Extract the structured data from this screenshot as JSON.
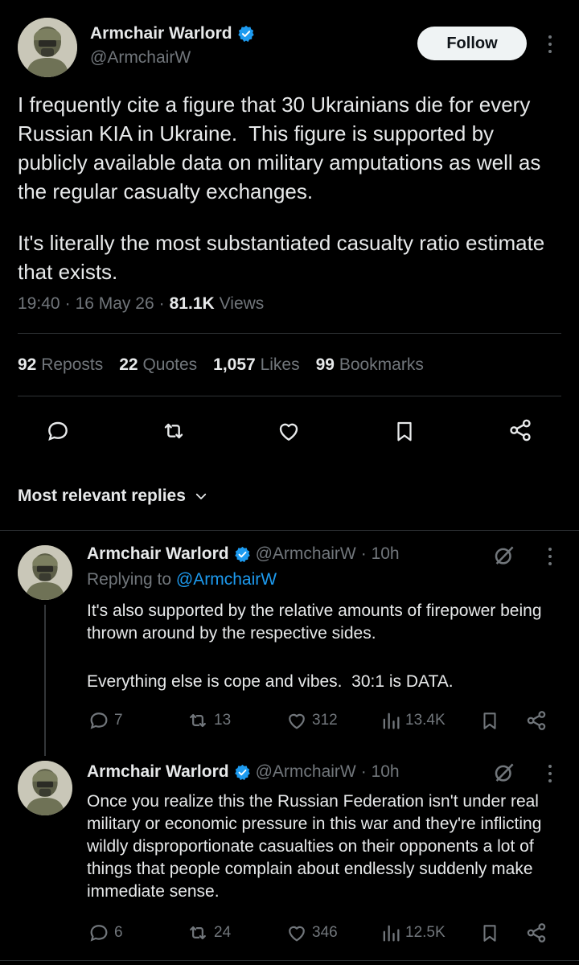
{
  "main_tweet": {
    "author_name": "Armchair Warlord",
    "handle": "@ArmchairW",
    "follow_label": "Follow",
    "text_p1": "I frequently cite a figure that 30 Ukrainians die for every Russian KIA in Ukraine.  This figure is supported by publicly available data on military amputations as well as the regular casualty exchanges.",
    "text_p2": "It's literally the most substantiated casualty ratio estimate that exists.",
    "time": "19:40",
    "date": "16 May 26",
    "views_count": "81.1K",
    "views_label": "Views",
    "sep": "·",
    "stats": {
      "reposts_count": "92",
      "reposts_label": "Reposts",
      "quotes_count": "22",
      "quotes_label": "Quotes",
      "likes_count": "1,057",
      "likes_label": "Likes",
      "bookmarks_count": "99",
      "bookmarks_label": "Bookmarks"
    }
  },
  "replies_header": {
    "label": "Most relevant replies"
  },
  "replies": [
    {
      "author_name": "Armchair Warlord",
      "handle": "@ArmchairW",
      "time": "· 10h",
      "replying_prefix": "Replying to ",
      "replying_handle": "@ArmchairW",
      "text_p1": "It's also supported by the relative amounts of firepower being thrown around by the respective sides.",
      "text_p2": "Everything else is cope and vibes.  30:1 is DATA.",
      "replies_count": "7",
      "reposts_count": "13",
      "likes_count": "312",
      "views_count": "13.4K"
    },
    {
      "author_name": "Armchair Warlord",
      "handle": "@ArmchairW",
      "time": "· 10h",
      "text_p1": "Once you realize this the Russian Federation isn't under real military or economic pressure in this war and they're inflicting wildly disproportionate casualties on their opponents a lot of things that people complain about endlessly suddenly make immediate sense.",
      "replies_count": "6",
      "reposts_count": "24",
      "likes_count": "346",
      "views_count": "12.5K"
    }
  ],
  "colors": {
    "accent": "#1d9bf0",
    "muted": "#71767b",
    "divider": "#2f3336",
    "background": "#000000"
  },
  "icons": [
    "verified-badge-icon",
    "more-icon",
    "reply-icon",
    "repost-icon",
    "like-icon",
    "bookmark-icon",
    "share-icon",
    "grok-icon",
    "views-icon",
    "chevron-down-icon"
  ]
}
